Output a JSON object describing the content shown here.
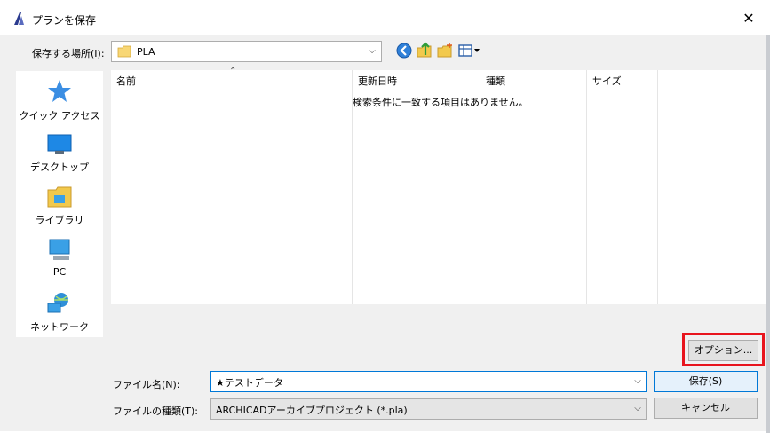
{
  "window": {
    "title": "プランを保存"
  },
  "location": {
    "label": "保存する場所(I):",
    "value": "PLA"
  },
  "places": [
    {
      "label": "クイック アクセス",
      "icon": "star-icon"
    },
    {
      "label": "デスクトップ",
      "icon": "desktop-icon"
    },
    {
      "label": "ライブラリ",
      "icon": "library-icon"
    },
    {
      "label": "PC",
      "icon": "pc-icon"
    },
    {
      "label": "ネットワーク",
      "icon": "network-icon"
    }
  ],
  "filelist": {
    "columns": [
      "名前",
      "更新日時",
      "種類",
      "サイズ"
    ],
    "empty_message": "検索条件に一致する項目はありません。"
  },
  "buttons": {
    "options": "オプション...",
    "save": "保存(S)",
    "cancel": "キャンセル"
  },
  "filename": {
    "label": "ファイル名(N):",
    "value": "★テストデータ"
  },
  "filetype": {
    "label": "ファイルの種類(T):",
    "value": "ARCHICADアーカイブプロジェクト (*.pla)"
  },
  "colors": {
    "highlight": "#e8141d",
    "accent": "#0078d7"
  }
}
